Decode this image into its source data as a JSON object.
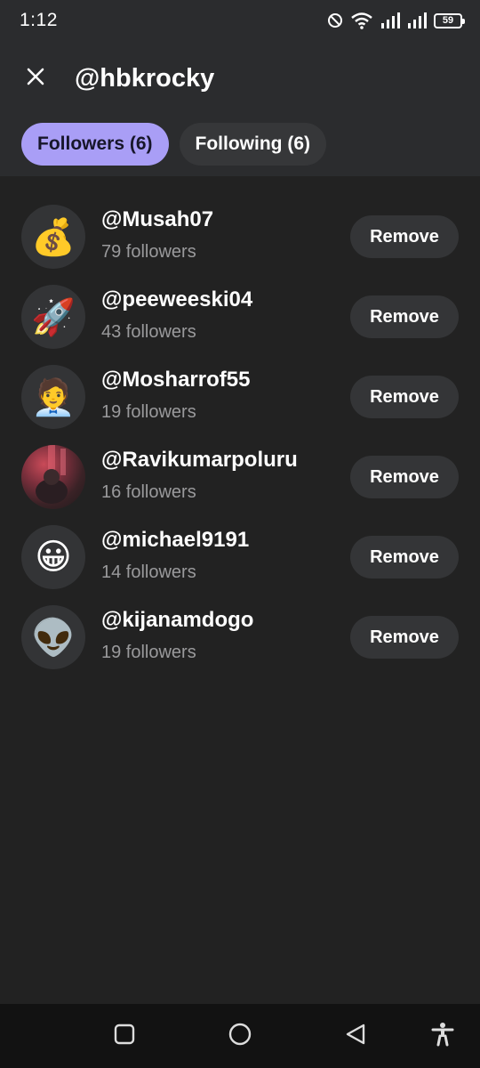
{
  "status_bar": {
    "time": "1:12",
    "battery": "59",
    "icons": [
      "do-not-disturb-icon",
      "wifi-icon",
      "signal-icon",
      "signal-icon",
      "battery-icon"
    ]
  },
  "header": {
    "title": "@hbkrocky",
    "close_icon": "close-icon",
    "tabs": [
      {
        "label": "Followers (6)",
        "active": true
      },
      {
        "label": "Following (6)",
        "active": false
      }
    ]
  },
  "followers": [
    {
      "avatar": "💰",
      "username": "@Musah07",
      "followers": "79 followers",
      "action": "Remove"
    },
    {
      "avatar": "🚀",
      "username": "@peeweeski04",
      "followers": "43 followers",
      "action": "Remove"
    },
    {
      "avatar": "🧑‍💼",
      "username": "@Mosharrof55",
      "followers": "19 followers",
      "action": "Remove"
    },
    {
      "avatar": "",
      "username": "@Ravikumarpoluru",
      "followers": "16 followers",
      "action": "Remove"
    },
    {
      "avatar": "😀",
      "username": "@michael9191",
      "followers": "14 followers",
      "action": "Remove"
    },
    {
      "avatar": "👽",
      "username": "@kijanamdogo",
      "followers": "19 followers",
      "action": "Remove"
    }
  ],
  "nav_bar": {
    "icons": [
      "recents-icon",
      "home-icon",
      "back-icon",
      "accessibility-icon"
    ]
  },
  "colors": {
    "accent": "#a99ef6",
    "background": "#222222",
    "header": "#2b2c2e"
  }
}
